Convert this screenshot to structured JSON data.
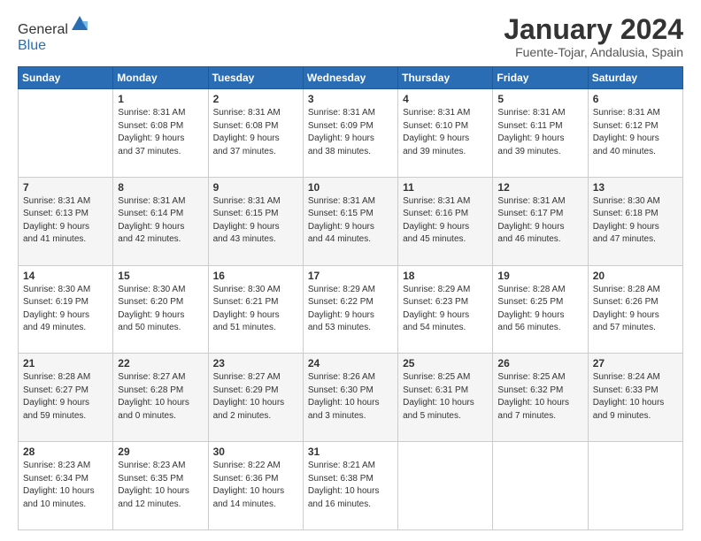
{
  "logo": {
    "general": "General",
    "blue": "Blue"
  },
  "title": "January 2024",
  "subtitle": "Fuente-Tojar, Andalusia, Spain",
  "days_header": [
    "Sunday",
    "Monday",
    "Tuesday",
    "Wednesday",
    "Thursday",
    "Friday",
    "Saturday"
  ],
  "weeks": [
    [
      {
        "day": "",
        "sunrise": "",
        "sunset": "",
        "daylight": ""
      },
      {
        "day": "1",
        "sunrise": "Sunrise: 8:31 AM",
        "sunset": "Sunset: 6:08 PM",
        "daylight": "Daylight: 9 hours and 37 minutes."
      },
      {
        "day": "2",
        "sunrise": "Sunrise: 8:31 AM",
        "sunset": "Sunset: 6:08 PM",
        "daylight": "Daylight: 9 hours and 37 minutes."
      },
      {
        "day": "3",
        "sunrise": "Sunrise: 8:31 AM",
        "sunset": "Sunset: 6:09 PM",
        "daylight": "Daylight: 9 hours and 38 minutes."
      },
      {
        "day": "4",
        "sunrise": "Sunrise: 8:31 AM",
        "sunset": "Sunset: 6:10 PM",
        "daylight": "Daylight: 9 hours and 39 minutes."
      },
      {
        "day": "5",
        "sunrise": "Sunrise: 8:31 AM",
        "sunset": "Sunset: 6:11 PM",
        "daylight": "Daylight: 9 hours and 39 minutes."
      },
      {
        "day": "6",
        "sunrise": "Sunrise: 8:31 AM",
        "sunset": "Sunset: 6:12 PM",
        "daylight": "Daylight: 9 hours and 40 minutes."
      }
    ],
    [
      {
        "day": "7",
        "sunrise": "Sunrise: 8:31 AM",
        "sunset": "Sunset: 6:13 PM",
        "daylight": "Daylight: 9 hours and 41 minutes."
      },
      {
        "day": "8",
        "sunrise": "Sunrise: 8:31 AM",
        "sunset": "Sunset: 6:14 PM",
        "daylight": "Daylight: 9 hours and 42 minutes."
      },
      {
        "day": "9",
        "sunrise": "Sunrise: 8:31 AM",
        "sunset": "Sunset: 6:15 PM",
        "daylight": "Daylight: 9 hours and 43 minutes."
      },
      {
        "day": "10",
        "sunrise": "Sunrise: 8:31 AM",
        "sunset": "Sunset: 6:15 PM",
        "daylight": "Daylight: 9 hours and 44 minutes."
      },
      {
        "day": "11",
        "sunrise": "Sunrise: 8:31 AM",
        "sunset": "Sunset: 6:16 PM",
        "daylight": "Daylight: 9 hours and 45 minutes."
      },
      {
        "day": "12",
        "sunrise": "Sunrise: 8:31 AM",
        "sunset": "Sunset: 6:17 PM",
        "daylight": "Daylight: 9 hours and 46 minutes."
      },
      {
        "day": "13",
        "sunrise": "Sunrise: 8:30 AM",
        "sunset": "Sunset: 6:18 PM",
        "daylight": "Daylight: 9 hours and 47 minutes."
      }
    ],
    [
      {
        "day": "14",
        "sunrise": "Sunrise: 8:30 AM",
        "sunset": "Sunset: 6:19 PM",
        "daylight": "Daylight: 9 hours and 49 minutes."
      },
      {
        "day": "15",
        "sunrise": "Sunrise: 8:30 AM",
        "sunset": "Sunset: 6:20 PM",
        "daylight": "Daylight: 9 hours and 50 minutes."
      },
      {
        "day": "16",
        "sunrise": "Sunrise: 8:30 AM",
        "sunset": "Sunset: 6:21 PM",
        "daylight": "Daylight: 9 hours and 51 minutes."
      },
      {
        "day": "17",
        "sunrise": "Sunrise: 8:29 AM",
        "sunset": "Sunset: 6:22 PM",
        "daylight": "Daylight: 9 hours and 53 minutes."
      },
      {
        "day": "18",
        "sunrise": "Sunrise: 8:29 AM",
        "sunset": "Sunset: 6:23 PM",
        "daylight": "Daylight: 9 hours and 54 minutes."
      },
      {
        "day": "19",
        "sunrise": "Sunrise: 8:28 AM",
        "sunset": "Sunset: 6:25 PM",
        "daylight": "Daylight: 9 hours and 56 minutes."
      },
      {
        "day": "20",
        "sunrise": "Sunrise: 8:28 AM",
        "sunset": "Sunset: 6:26 PM",
        "daylight": "Daylight: 9 hours and 57 minutes."
      }
    ],
    [
      {
        "day": "21",
        "sunrise": "Sunrise: 8:28 AM",
        "sunset": "Sunset: 6:27 PM",
        "daylight": "Daylight: 9 hours and 59 minutes."
      },
      {
        "day": "22",
        "sunrise": "Sunrise: 8:27 AM",
        "sunset": "Sunset: 6:28 PM",
        "daylight": "Daylight: 10 hours and 0 minutes."
      },
      {
        "day": "23",
        "sunrise": "Sunrise: 8:27 AM",
        "sunset": "Sunset: 6:29 PM",
        "daylight": "Daylight: 10 hours and 2 minutes."
      },
      {
        "day": "24",
        "sunrise": "Sunrise: 8:26 AM",
        "sunset": "Sunset: 6:30 PM",
        "daylight": "Daylight: 10 hours and 3 minutes."
      },
      {
        "day": "25",
        "sunrise": "Sunrise: 8:25 AM",
        "sunset": "Sunset: 6:31 PM",
        "daylight": "Daylight: 10 hours and 5 minutes."
      },
      {
        "day": "26",
        "sunrise": "Sunrise: 8:25 AM",
        "sunset": "Sunset: 6:32 PM",
        "daylight": "Daylight: 10 hours and 7 minutes."
      },
      {
        "day": "27",
        "sunrise": "Sunrise: 8:24 AM",
        "sunset": "Sunset: 6:33 PM",
        "daylight": "Daylight: 10 hours and 9 minutes."
      }
    ],
    [
      {
        "day": "28",
        "sunrise": "Sunrise: 8:23 AM",
        "sunset": "Sunset: 6:34 PM",
        "daylight": "Daylight: 10 hours and 10 minutes."
      },
      {
        "day": "29",
        "sunrise": "Sunrise: 8:23 AM",
        "sunset": "Sunset: 6:35 PM",
        "daylight": "Daylight: 10 hours and 12 minutes."
      },
      {
        "day": "30",
        "sunrise": "Sunrise: 8:22 AM",
        "sunset": "Sunset: 6:36 PM",
        "daylight": "Daylight: 10 hours and 14 minutes."
      },
      {
        "day": "31",
        "sunrise": "Sunrise: 8:21 AM",
        "sunset": "Sunset: 6:38 PM",
        "daylight": "Daylight: 10 hours and 16 minutes."
      },
      {
        "day": "",
        "sunrise": "",
        "sunset": "",
        "daylight": ""
      },
      {
        "day": "",
        "sunrise": "",
        "sunset": "",
        "daylight": ""
      },
      {
        "day": "",
        "sunrise": "",
        "sunset": "",
        "daylight": ""
      }
    ]
  ]
}
